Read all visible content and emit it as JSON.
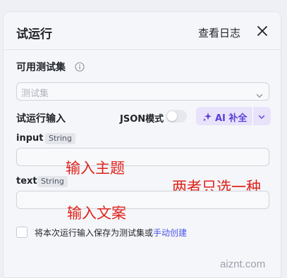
{
  "header": {
    "title": "试运行",
    "log_link": "查看日志",
    "close_icon": "close-icon"
  },
  "test_set": {
    "label": "可用测试集",
    "info_icon": "info-icon",
    "placeholder": "测试集"
  },
  "run_input": {
    "label": "试运行输入",
    "json_mode_label": "JSON模式",
    "json_mode_on": false,
    "ai_button_label": "AI 补全"
  },
  "fields": [
    {
      "name": "input",
      "type": "String",
      "value": ""
    },
    {
      "name": "text",
      "type": "String",
      "value": ""
    }
  ],
  "annotations": {
    "input_note": "输入主题",
    "text_note": "输入文案",
    "side_note": "两者只选一种"
  },
  "save_option": {
    "text": "将本次运行输入保存为测试集或",
    "link": "手动创建",
    "checked": false
  },
  "watermark": "aiznt.com",
  "colors": {
    "accent": "#4d53e8",
    "ai_purple": "#5b3fd6",
    "annotation_red": "#e0231c"
  }
}
